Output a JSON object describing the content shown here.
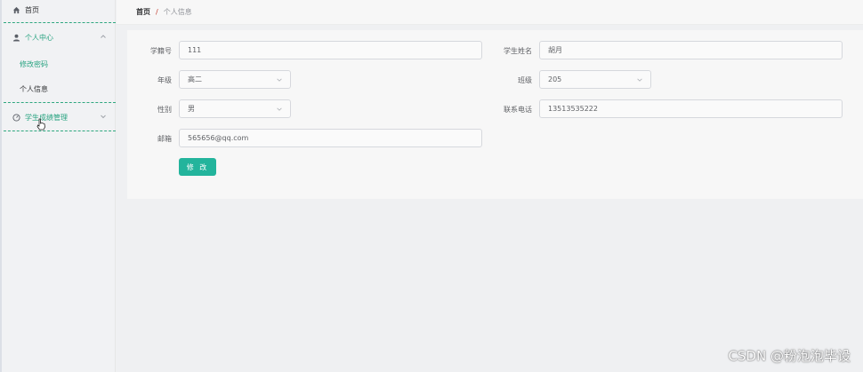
{
  "sidebar": {
    "home": {
      "label": "首页",
      "icon": "home-icon"
    },
    "personal_center": {
      "label": "个人中心",
      "icon": "user-icon",
      "expanded": true,
      "children": [
        {
          "label": "修改密码"
        },
        {
          "label": "个人信息"
        }
      ]
    },
    "score_management": {
      "label": "学生成绩管理",
      "icon": "dashboard-icon",
      "expanded": false
    }
  },
  "breadcrumb": {
    "home": "首页",
    "separator": "/",
    "current": "个人信息"
  },
  "form": {
    "student_id": {
      "label": "学籍号",
      "value": "111"
    },
    "student_name": {
      "label": "学生姓名",
      "value": "胡月"
    },
    "grade": {
      "label": "年级",
      "value": "高二"
    },
    "class": {
      "label": "班级",
      "value": "205"
    },
    "gender": {
      "label": "性别",
      "value": "男"
    },
    "phone": {
      "label": "联系电话",
      "value": "13513535222"
    },
    "email": {
      "label": "邮箱",
      "value": "565656@qq.com"
    },
    "submit_label": "修 改"
  },
  "watermark": "CSDN @粉泡泡毕设",
  "colors": {
    "accent": "#23b49c",
    "menu_green": "#28a380",
    "breadcrumb_sep": "#c0392b"
  }
}
